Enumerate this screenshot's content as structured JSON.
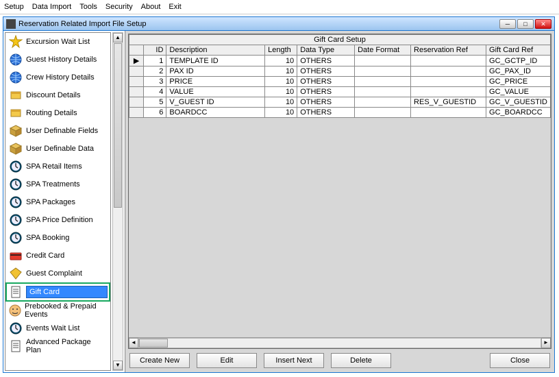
{
  "menu": [
    "Setup",
    "Data Import",
    "Tools",
    "Security",
    "About",
    "Exit"
  ],
  "window": {
    "title": "Reservation Related Import File Setup",
    "min": "─",
    "max": "□",
    "close": "✕"
  },
  "sidebar": {
    "items": [
      {
        "icon": "star",
        "label": "Excursion Wait List"
      },
      {
        "icon": "globe",
        "label": "Guest History Details"
      },
      {
        "icon": "globe",
        "label": "Crew History Details"
      },
      {
        "icon": "box",
        "label": "Discount Details"
      },
      {
        "icon": "box",
        "label": "Routing Details"
      },
      {
        "icon": "cube",
        "label": "User Definable Fields"
      },
      {
        "icon": "cube",
        "label": "User Definable Data"
      },
      {
        "icon": "clock",
        "label": "SPA Retail Items"
      },
      {
        "icon": "clock",
        "label": "SPA Treatments"
      },
      {
        "icon": "clock",
        "label": "SPA Packages"
      },
      {
        "icon": "clock",
        "label": "SPA Price Definition"
      },
      {
        "icon": "clock",
        "label": "SPA Booking"
      },
      {
        "icon": "card",
        "label": "Credit Card"
      },
      {
        "icon": "diamond",
        "label": "Guest Complaint"
      },
      {
        "icon": "doc",
        "label": "Gift Card",
        "selected": true
      },
      {
        "icon": "face",
        "label": "Prebooked & Prepaid Events"
      },
      {
        "icon": "clock",
        "label": "Events Wait List"
      },
      {
        "icon": "doc",
        "label": "Advanced Package Plan"
      }
    ]
  },
  "grid": {
    "title": "Gift Card Setup",
    "columns": [
      "ID",
      "Description",
      "Length",
      "Data Type",
      "Date Format",
      "Reservation Ref",
      "Gift Card Ref"
    ],
    "rows": [
      {
        "id": "1",
        "desc": "TEMPLATE ID",
        "len": "10",
        "type": "OTHERS",
        "fmt": "",
        "rref": "",
        "gref": "GC_GCTP_ID",
        "current": true
      },
      {
        "id": "2",
        "desc": "PAX ID",
        "len": "10",
        "type": "OTHERS",
        "fmt": "",
        "rref": "",
        "gref": "GC_PAX_ID"
      },
      {
        "id": "3",
        "desc": "PRICE",
        "len": "10",
        "type": "OTHERS",
        "fmt": "",
        "rref": "",
        "gref": "GC_PRICE"
      },
      {
        "id": "4",
        "desc": "VALUE",
        "len": "10",
        "type": "OTHERS",
        "fmt": "",
        "rref": "",
        "gref": "GC_VALUE"
      },
      {
        "id": "5",
        "desc": "V_GUEST ID",
        "len": "10",
        "type": "OTHERS",
        "fmt": "",
        "rref": "RES_V_GUESTID",
        "gref": "GC_V_GUESTID"
      },
      {
        "id": "6",
        "desc": "BOARDCC",
        "len": "10",
        "type": "OTHERS",
        "fmt": "",
        "rref": "",
        "gref": "GC_BOARDCC"
      }
    ]
  },
  "buttons": {
    "create": "Create New",
    "edit": "Edit",
    "insert": "Insert Next",
    "delete": "Delete",
    "close": "Close"
  }
}
